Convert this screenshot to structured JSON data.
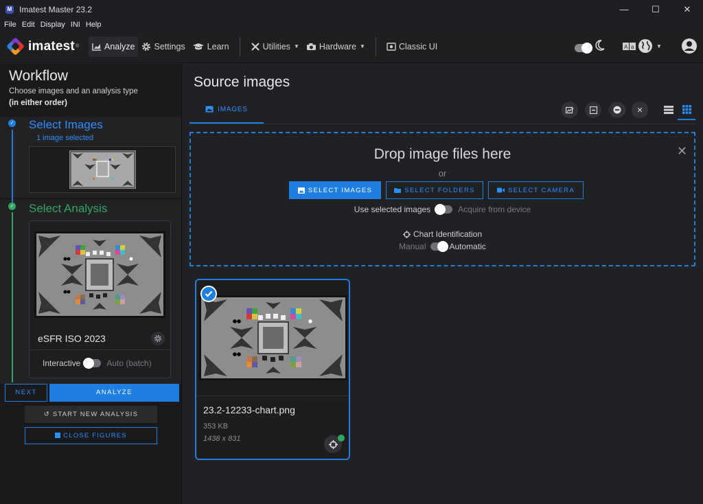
{
  "window": {
    "title": "Imatest Master 23.2",
    "icon": "imatest-app-icon"
  },
  "menu": [
    "File",
    "Edit",
    "Display",
    "INI",
    "Help"
  ],
  "toolbar": {
    "logo_text": "imatest",
    "analyze": "Analyze",
    "settings": "Settings",
    "learn": "Learn",
    "utilities": "Utilities",
    "hardware": "Hardware",
    "classic_ui": "Classic UI"
  },
  "workflow": {
    "title": "Workflow",
    "subtitle": "Choose images and an analysis type",
    "subtitle2": "(in either order)",
    "step1": {
      "title": "Select Images",
      "sub": "1 image selected"
    },
    "step2": {
      "title": "Select Analysis",
      "analysis_name": "eSFR ISO 2023"
    },
    "interactive_label": "Interactive",
    "auto_label": "Auto (batch)",
    "next": "NEXT",
    "analyze": "ANALYZE",
    "start_new": "START NEW ANALYSIS",
    "close_figures": "CLOSE FIGURES"
  },
  "source": {
    "title": "Source images",
    "tab_images": "IMAGES",
    "drop_title": "Drop image files here",
    "drop_or": "or",
    "btn_select_images": "SELECT IMAGES",
    "btn_select_folders": "SELECT FOLDERS",
    "btn_select_camera": "SELECT CAMERA",
    "use_selected": "Use selected images",
    "acquire": "Acquire from device",
    "chart_id": "Chart Identification",
    "manual": "Manual",
    "automatic": "Automatic"
  },
  "image_card": {
    "filename": "23.2-12233-chart.png",
    "size": "353 KB",
    "dims": "1438 x 831"
  },
  "colors": {
    "accent": "#1e7fe0",
    "success": "#2ea860",
    "bg": "#202124",
    "panel": "#1a1a1c"
  }
}
